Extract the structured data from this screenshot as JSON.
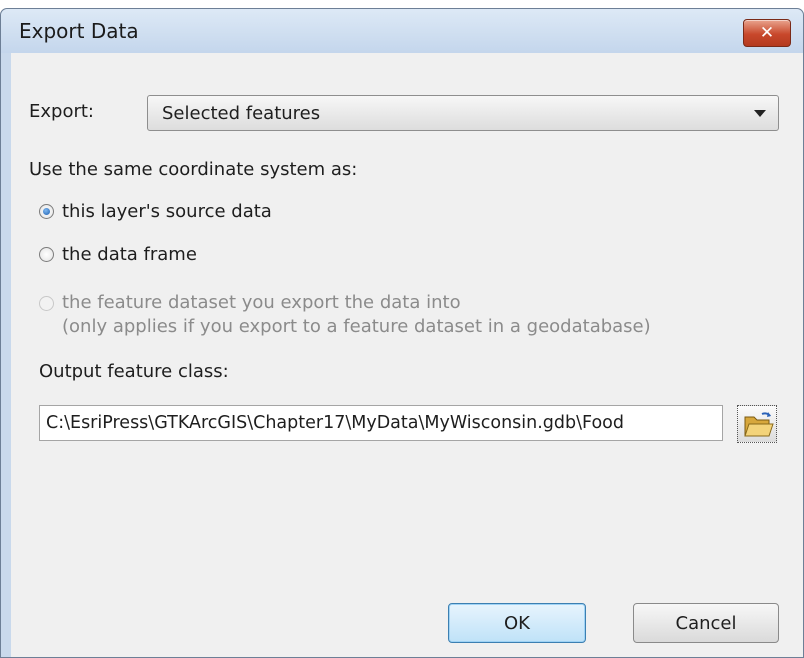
{
  "window": {
    "title": "Export Data",
    "close_label": "✕"
  },
  "export": {
    "label": "Export:",
    "selected": "Selected features"
  },
  "coordinate_system": {
    "label": "Use the same coordinate system as:",
    "options": [
      {
        "label": "this layer's source data",
        "checked": true,
        "enabled": true
      },
      {
        "label": "the data frame",
        "checked": false,
        "enabled": true
      },
      {
        "label": "the feature dataset you export the data into",
        "note": "(only applies if you export to a feature dataset in a geodatabase)",
        "checked": false,
        "enabled": false
      }
    ]
  },
  "output": {
    "label": "Output feature class:",
    "value": "C:\\EsriPress\\GTKArcGIS\\Chapter17\\MyData\\MyWisconsin.gdb\\Food",
    "browse_icon": "open-folder-icon"
  },
  "buttons": {
    "ok": "OK",
    "cancel": "Cancel"
  },
  "colors": {
    "titlebar": "#c9d9ec",
    "client": "#f0f0f0",
    "close_button": "#c8482b",
    "default_button": "#bfe2f8"
  }
}
